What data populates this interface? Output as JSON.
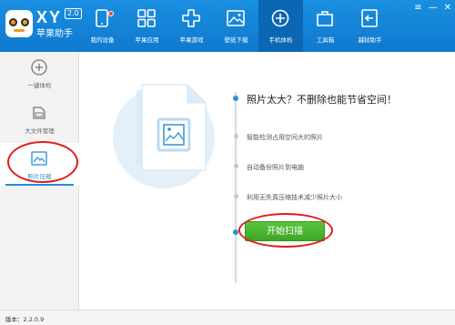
{
  "brand": {
    "name": "XY",
    "version_badge": "2.0",
    "subtitle": "苹果助手"
  },
  "nav": {
    "items": [
      {
        "label": "我的设备",
        "icon": "device-icon"
      },
      {
        "label": "苹果应用",
        "icon": "apps-icon"
      },
      {
        "label": "苹果游戏",
        "icon": "game-icon"
      },
      {
        "label": "壁纸下载",
        "icon": "wallpaper-icon"
      },
      {
        "label": "手机体检",
        "icon": "checkup-icon",
        "active": true
      },
      {
        "label": "工具箱",
        "icon": "toolbox-icon"
      },
      {
        "label": "越狱助手",
        "icon": "jailbreak-icon"
      }
    ]
  },
  "window_controls": {
    "menu": "≡",
    "minimize": "—",
    "close": "✕"
  },
  "sidebar": {
    "items": [
      {
        "label": "一键体检",
        "icon": "plus-circle-icon"
      },
      {
        "label": "大文件管理",
        "icon": "disk-icon"
      },
      {
        "label": "照片压缩",
        "icon": "photo-icon",
        "active": true
      }
    ]
  },
  "main": {
    "headline": "照片太大？不删除也能节省空间！",
    "features": [
      "智能检测占用空间大的照片",
      "自动备份照片到电脑",
      "利用无失真压缩技术减少照片大小"
    ],
    "scan_button": "开始扫描"
  },
  "status": {
    "version": "版本：2.2.0.9"
  },
  "colors": {
    "accent": "#1d8fdb",
    "button_green": "#4cb532",
    "annotation_red": "#e11b1b"
  }
}
